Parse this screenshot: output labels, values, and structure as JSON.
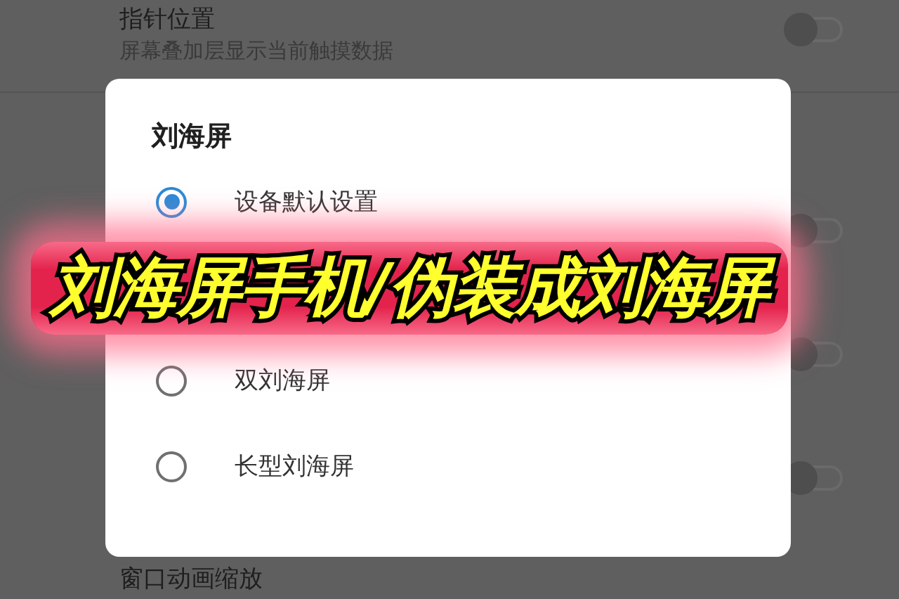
{
  "settings": [
    {
      "title": "指针位置",
      "subtitle": "屏幕叠加层显示当前触摸数据",
      "switch": {
        "on": false
      }
    },
    {
      "switch": {
        "on": false
      }
    },
    {
      "switch": {
        "on": false
      }
    },
    {
      "switch": {
        "on": false
      }
    },
    {
      "title": "窗口动画缩放"
    }
  ],
  "dialog": {
    "title": "刘海屏",
    "options": [
      {
        "label": "设备默认设置",
        "selected": true
      },
      {
        "label": "双刘海屏",
        "selected": false
      },
      {
        "label": "长型刘海屏",
        "selected": false
      }
    ]
  },
  "banner": "刘海屏手机/伪装成刘海屏"
}
